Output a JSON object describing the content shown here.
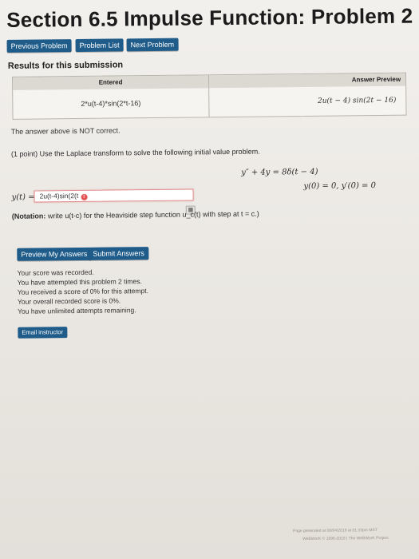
{
  "page": {
    "title": "Section 6.5 Impulse Function: Problem 2"
  },
  "nav": {
    "previous": "Previous Problem",
    "list": "Problem List",
    "next": "Next Problem"
  },
  "results": {
    "heading": "Results for this submission",
    "col_entered": "Entered",
    "col_preview": "Answer Preview",
    "entered_value": "2*u(t-4)*sin(2*t-16)",
    "preview_value": "2u(t − 4) sin(2t − 16)",
    "message": "The answer above is NOT correct."
  },
  "problem": {
    "statement": "(1 point) Use the Laplace transform to solve the following initial value problem.",
    "equation": "y″ + 4y = 8δ(t − 4)",
    "initial_conditions": "y(0) = 0,  y′(0) = 0",
    "answer_label": "y(t) =",
    "answer_value": "2u(t-4)sin(2(t",
    "notation_bold": "(Notation:",
    "notation_rest": "write u(t-c) for the Heaviside step function u_c(t) with step at t = c.)"
  },
  "actions": {
    "preview": "Preview My Answers",
    "submit": "Submit Answers"
  },
  "status": {
    "lines": [
      "Your score was recorded.",
      "You have attempted this problem 2 times.",
      "You received a score of 0% for this attempt.",
      "Your overall recorded score is 0%.",
      "You have unlimited attempts remaining."
    ]
  },
  "email": {
    "label": "Email instructor"
  },
  "footer": {
    "line1": "Page generated at 08/04/2019 at 01:33pm MST",
    "line2": "WeBWorK © 1996-2019 | The WeBWorK Project"
  },
  "colors": {
    "button": "#1f5c8a",
    "error_border": "#e08b8b",
    "error_icon": "#e45454"
  }
}
